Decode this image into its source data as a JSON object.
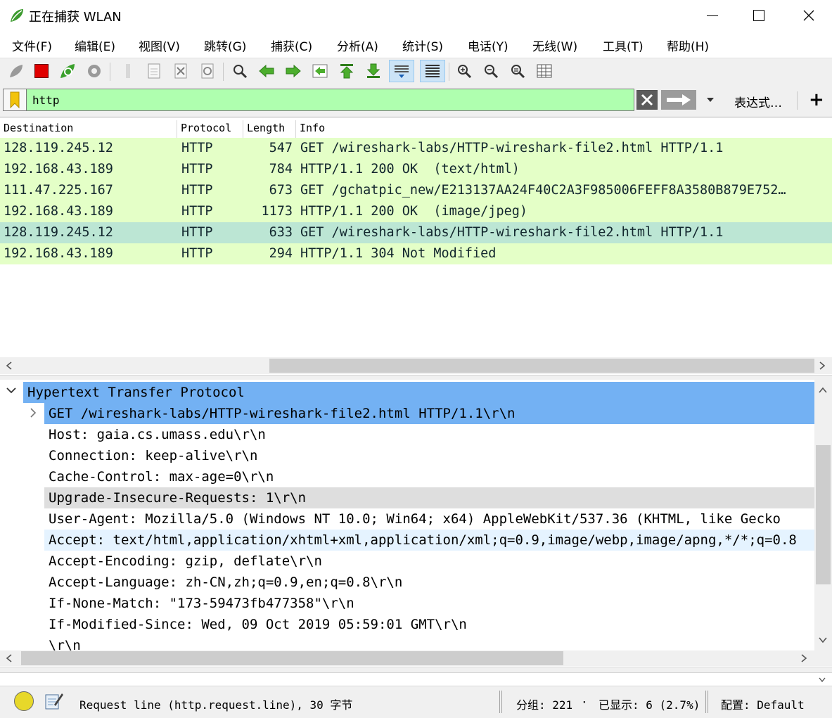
{
  "window": {
    "title": "正在捕获 WLAN",
    "minimize_glyph": "—",
    "maximize_glyph": "☐",
    "close_glyph": "✕"
  },
  "menu": {
    "items": [
      "文件(F)",
      "编辑(E)",
      "视图(V)",
      "跳转(G)",
      "捕获(C)",
      "分析(A)",
      "统计(S)",
      "电话(Y)",
      "无线(W)",
      "工具(T)",
      "帮助(H)"
    ]
  },
  "toolbar": {
    "icons": [
      "start-capture-icon",
      "stop-capture-icon",
      "restart-capture-icon",
      "capture-options-icon",
      "open-file-icon",
      "save-file-icon",
      "close-file-icon",
      "reload-file-icon",
      "find-packet-icon",
      "go-back-icon",
      "go-forward-icon",
      "go-to-packet-icon",
      "go-first-icon",
      "go-last-icon",
      "auto-scroll-icon",
      "colorize-icon",
      "zoom-in-icon",
      "zoom-out-icon",
      "normal-size-icon",
      "resize-columns-icon"
    ]
  },
  "filter": {
    "value": "http",
    "expression_label": "表达式…",
    "add_label": "+",
    "background": "#afffaf"
  },
  "packet_list": {
    "columns": [
      "Destination",
      "Protocol",
      "Length",
      "Info"
    ],
    "rows": [
      {
        "destination": "128.119.245.12",
        "protocol": "HTTP",
        "length": "547",
        "info": "GET /wireshark-labs/HTTP-wireshark-file2.html HTTP/1.1"
      },
      {
        "destination": "192.168.43.189",
        "protocol": "HTTP",
        "length": "784",
        "info": "HTTP/1.1 200 OK  (text/html)"
      },
      {
        "destination": "111.47.225.167",
        "protocol": "HTTP",
        "length": "673",
        "info": "GET /gchatpic_new/E213137AA24F40C2A3F985006FEFF8A3580B879E752…"
      },
      {
        "destination": "192.168.43.189",
        "protocol": "HTTP",
        "length": "1173",
        "info": "HTTP/1.1 200 OK  (image/jpeg)"
      },
      {
        "destination": "128.119.245.12",
        "protocol": "HTTP",
        "length": "633",
        "info": "GET /wireshark-labs/HTTP-wireshark-file2.html HTTP/1.1"
      },
      {
        "destination": "192.168.43.189",
        "protocol": "HTTP",
        "length": "294",
        "info": "HTTP/1.1 304 Not Modified"
      }
    ],
    "selected_index": 4,
    "row_color": "#e4ffc7",
    "selected_color": "#bce6d4"
  },
  "details": {
    "header": "Hypertext Transfer Protocol",
    "request_line": "GET /wireshark-labs/HTTP-wireshark-file2.html HTTP/1.1\\r\\n",
    "lines": [
      "Host: gaia.cs.umass.edu\\r\\n",
      "Connection: keep-alive\\r\\n",
      "Cache-Control: max-age=0\\r\\n",
      "Upgrade-Insecure-Requests: 1\\r\\n",
      "User-Agent: Mozilla/5.0 (Windows NT 10.0; Win64; x64) AppleWebKit/537.36 (KHTML, like Gecko",
      "Accept: text/html,application/xhtml+xml,application/xml;q=0.9,image/webp,image/apng,*/*;q=0.8",
      "Accept-Encoding: gzip, deflate\\r\\n",
      "Accept-Language: zh-CN,zh;q=0.9,en;q=0.8\\r\\n",
      "If-None-Match: \"173-59473fb477358\"\\r\\n",
      "If-Modified-Since: Wed, 09 Oct 2019 05:59:01 GMT\\r\\n",
      "\\r\\n"
    ],
    "highlight_color": "#73b1f3"
  },
  "status": {
    "field_info": "Request line (http.request.line), 30 字节",
    "packets": "分组: 221",
    "displayed": "已显示: 6 (2.7%)",
    "profile": "配置: Default"
  }
}
